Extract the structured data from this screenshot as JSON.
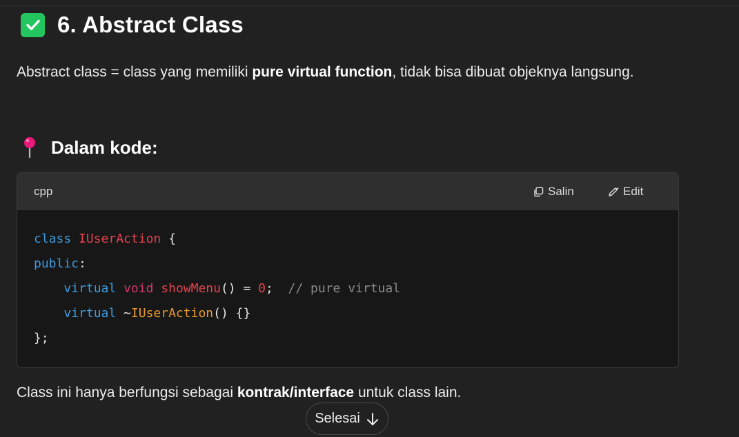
{
  "heading": {
    "icon": "check-box-icon",
    "title": "6. Abstract Class"
  },
  "intro": {
    "before": "Abstract class = class yang memiliki ",
    "bold": "pure virtual function",
    "after": ", tidak bisa dibuat objeknya langsung."
  },
  "subheading": {
    "icon": "pushpin-icon",
    "title": "Dalam kode:"
  },
  "code_block": {
    "language": "cpp",
    "copy_label": "Salin",
    "edit_label": "Edit",
    "lines": [
      "class IUserAction {",
      "public:",
      "    virtual void showMenu() = 0;  // pure virtual",
      "    virtual ~IUserAction() {}",
      "};"
    ]
  },
  "outro": {
    "before": "Class ini hanya berfungsi sebagai ",
    "bold": "kontrak/interface",
    "after": " untuk class lain."
  },
  "done_button": {
    "label": "Selesai",
    "icon": "arrow-down-icon"
  },
  "colors": {
    "background": "#212121",
    "check_green": "#22c55e",
    "pin_pink": "#e8197a",
    "keyword_blue": "#3d9be0",
    "identifier_red": "#e0434f",
    "destructor_orange": "#e89a2c",
    "comment_gray": "#8b8b8b"
  }
}
